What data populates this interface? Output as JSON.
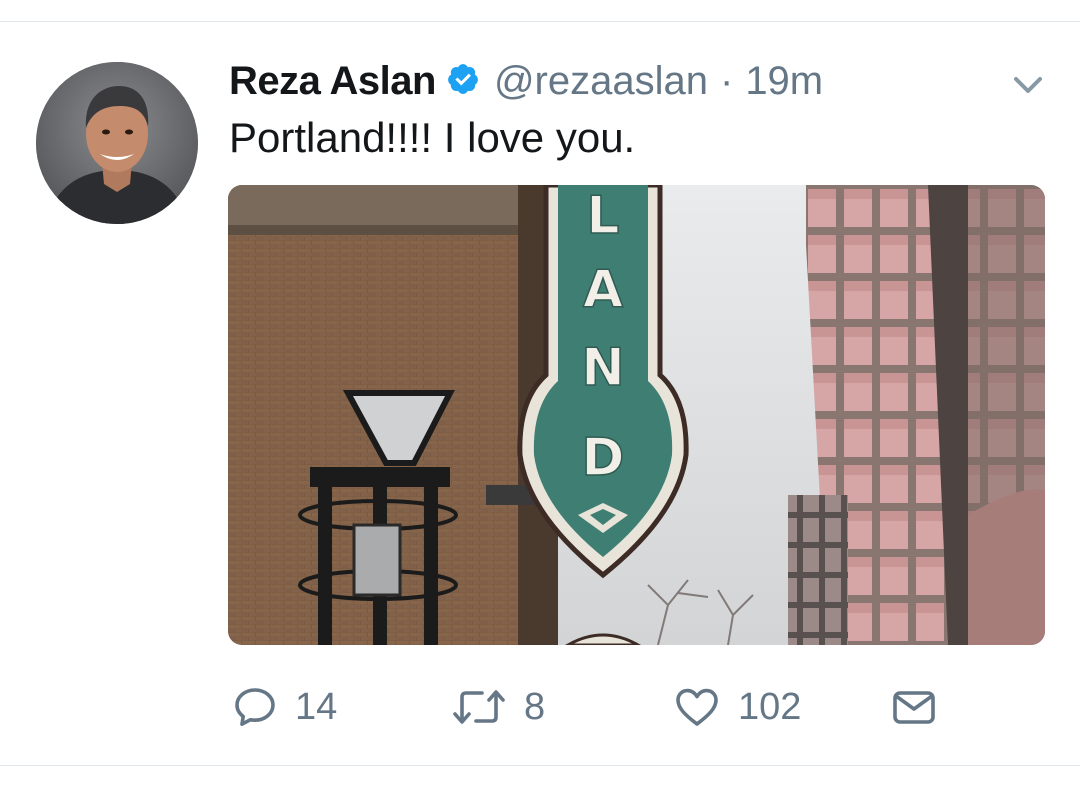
{
  "tweet": {
    "author_name": "Reza Aslan",
    "handle": "@rezaaslan",
    "separator": "·",
    "time": "19m",
    "text": "Portland!!!! I love you.",
    "verified": true
  },
  "media": {
    "sign_letters": [
      "L",
      "A",
      "N",
      "D"
    ]
  },
  "actions": {
    "reply_count": "14",
    "retweet_count": "8",
    "like_count": "102"
  },
  "colors": {
    "verified_blue": "#1da1f2",
    "meta_gray": "#657786",
    "divider": "#e1e8ed"
  },
  "icons": [
    "chevron-down-icon",
    "verified-badge-icon",
    "reply-icon",
    "retweet-icon",
    "heart-icon",
    "envelope-icon"
  ]
}
